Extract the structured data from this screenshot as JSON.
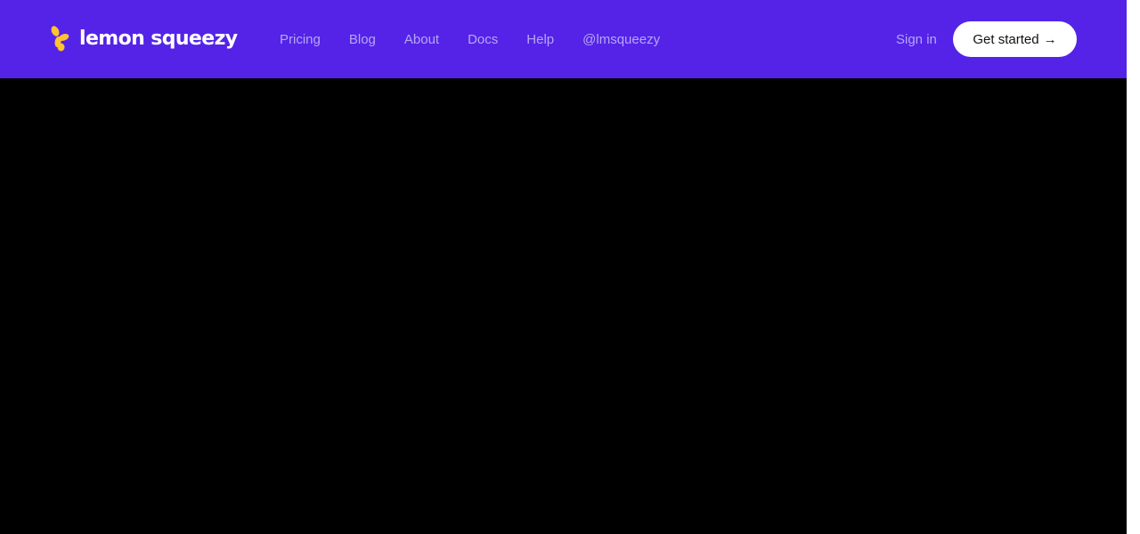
{
  "brand": {
    "name": "lemon squeezy",
    "icon": "lemon-petals-icon",
    "icon_color": "#ffc233"
  },
  "nav": {
    "items": [
      {
        "label": "Pricing"
      },
      {
        "label": "Blog"
      },
      {
        "label": "About"
      },
      {
        "label": "Docs"
      },
      {
        "label": "Help"
      },
      {
        "label": "@lmsqueezy"
      }
    ]
  },
  "auth": {
    "signin_label": "Sign in",
    "cta_label": "Get started",
    "cta_arrow": "→"
  },
  "colors": {
    "header_bg": "#5423e7",
    "nav_text": "#b9a6f6",
    "content_bg": "#000000"
  }
}
